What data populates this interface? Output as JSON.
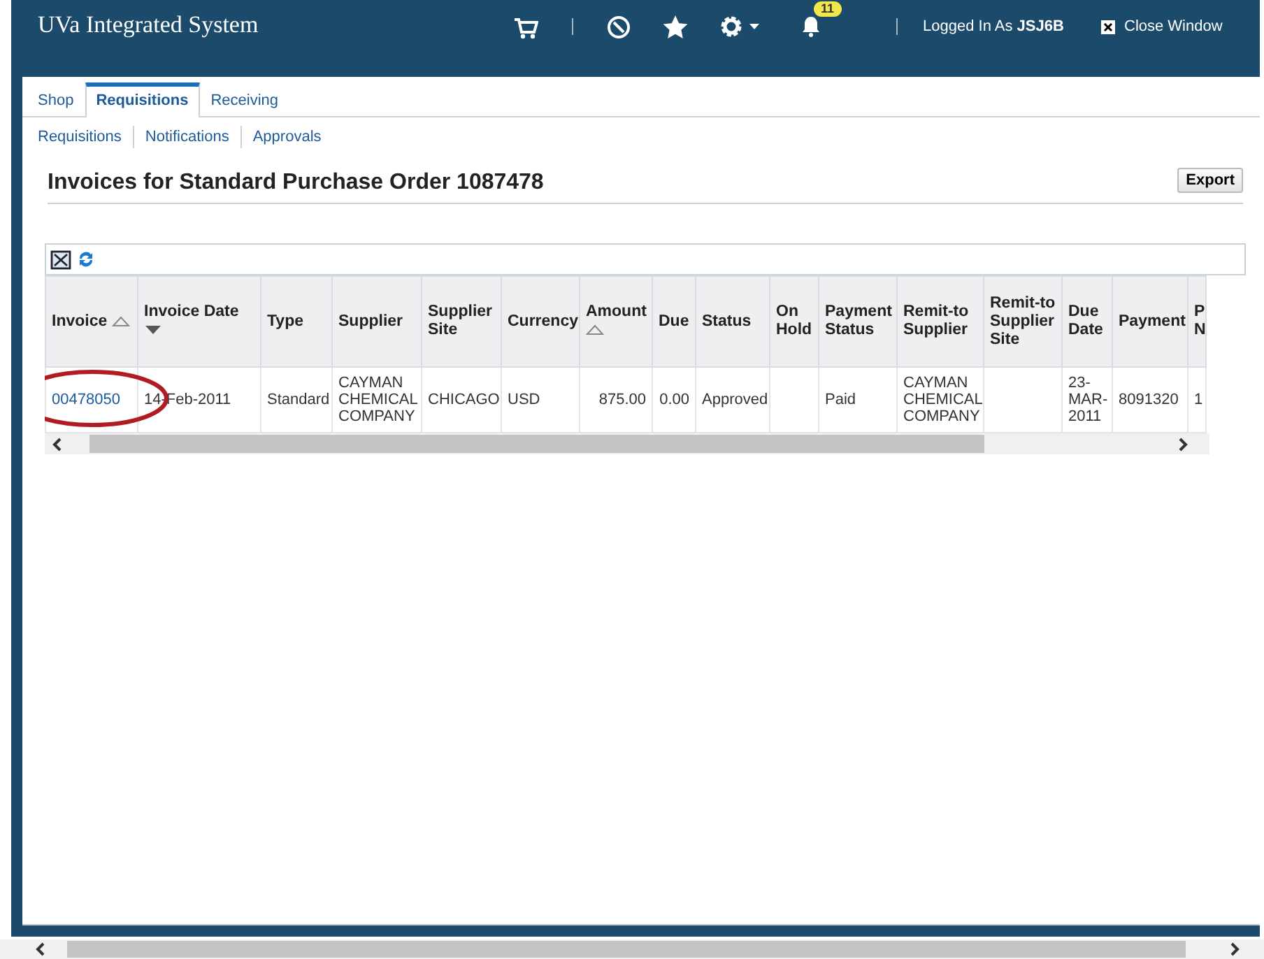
{
  "header": {
    "title": "UVa Integrated System",
    "notification_count": "11",
    "logged_in": "Logged In As **JSJ6B**",
    "close": "Close Window"
  },
  "tabs": [
    {
      "label": "Shop",
      "selected": false
    },
    {
      "label": "Requisitions",
      "selected": true
    },
    {
      "label": "Receiving",
      "selected": false
    }
  ],
  "subtabs": [
    "Requisitions",
    "Notifications",
    "Approvals"
  ],
  "page": {
    "title": "Invoices for Standard Purchase Order 1087478",
    "export": "Export"
  },
  "table": {
    "columns": [
      {
        "label": "Invoice",
        "sorted_ascending": true,
        "sorted_descending": false
      },
      {
        "label": "Invoice Date",
        "sorted_ascending": false,
        "sorted_descending": true
      },
      {
        "label": "Type",
        "sorted_ascending": false,
        "sorted_descending": false
      },
      {
        "label": "Supplier",
        "sorted_ascending": false,
        "sorted_descending": false
      },
      {
        "label": "Supplier Site",
        "sorted_ascending": false,
        "sorted_descending": false
      },
      {
        "label": "Currency",
        "sorted_ascending": false,
        "sorted_descending": false
      },
      {
        "label": "Amount",
        "sorted_ascending": true,
        "sorted_descending": false
      },
      {
        "label": "Due",
        "sorted_ascending": false,
        "sorted_descending": false
      },
      {
        "label": "Status",
        "sorted_ascending": false,
        "sorted_descending": false
      },
      {
        "label": "On Hold",
        "sorted_ascending": false,
        "sorted_descending": false
      },
      {
        "label": "Payment Status",
        "sorted_ascending": false,
        "sorted_descending": false
      },
      {
        "label": "Remit-to Supplier",
        "sorted_ascending": false,
        "sorted_descending": false
      },
      {
        "label": "Remit-to Supplier Site",
        "sorted_ascending": false,
        "sorted_descending": false
      },
      {
        "label": "Due Date",
        "sorted_ascending": false,
        "sorted_descending": false
      },
      {
        "label": "Payment",
        "sorted_ascending": false,
        "sorted_descending": false
      },
      {
        "label": "P N",
        "sorted_ascending": false,
        "sorted_descending": false
      }
    ],
    "rows": [
      {
        "cells": [
          "00478050",
          "14-Feb-2011",
          "Standard",
          "CAYMAN CHEMICAL COMPANY",
          "CHICAGO",
          "USD",
          "875.00",
          "0.00",
          "Approved",
          "",
          "Paid",
          "CAYMAN CHEMICAL COMPANY",
          "",
          "23-MAR-2011",
          "8091320",
          "1"
        ],
        "highlighted": true
      }
    ]
  }
}
